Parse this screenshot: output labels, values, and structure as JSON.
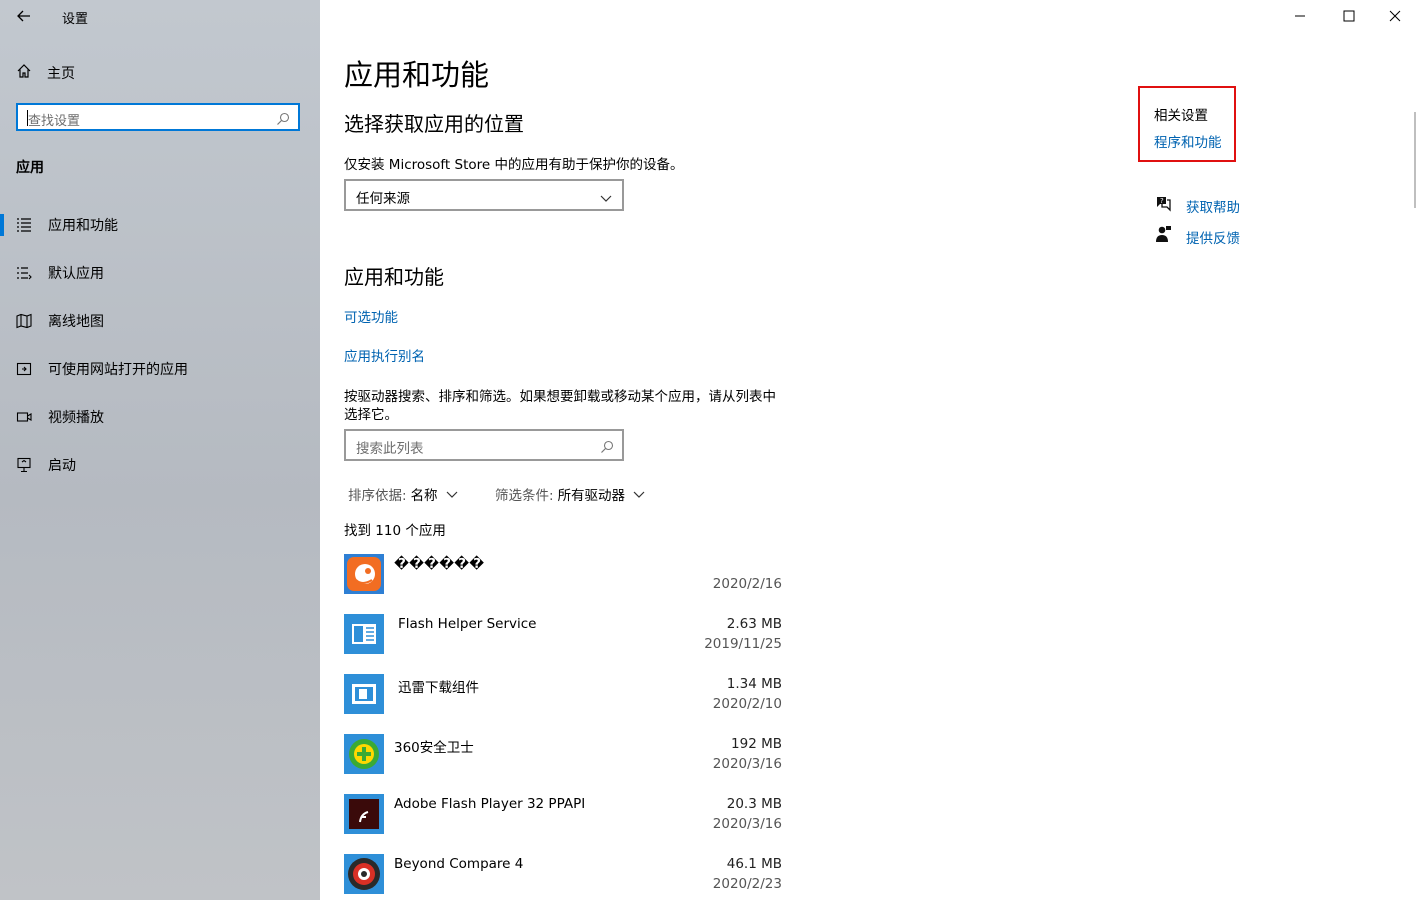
{
  "window": {
    "title": "设置"
  },
  "sidebar": {
    "home_label": "主页",
    "search_placeholder": "查找设置",
    "section_title": "应用",
    "items": [
      {
        "label": "应用和功能",
        "icon": "apps-list-icon",
        "selected": true
      },
      {
        "label": "默认应用",
        "icon": "default-apps-icon",
        "selected": false
      },
      {
        "label": "离线地图",
        "icon": "map-icon",
        "selected": false
      },
      {
        "label": "可使用网站打开的应用",
        "icon": "open-website-icon",
        "selected": false
      },
      {
        "label": "视频播放",
        "icon": "video-icon",
        "selected": false
      },
      {
        "label": "启动",
        "icon": "startup-icon",
        "selected": false
      }
    ]
  },
  "main": {
    "page_title": "应用和功能",
    "location_heading": "选择获取应用的位置",
    "location_desc": "仅安装 Microsoft Store 中的应用有助于保护你的设备。",
    "location_value": "任何来源",
    "apps_heading": "应用和功能",
    "link_optional": "可选功能",
    "link_alias": "应用执行别名",
    "list_desc_line1": "按驱动器搜索、排序和筛选。如果想要卸载或移动某个应用，请从列表中",
    "list_desc_line2": "选择它。",
    "list_search_placeholder": "搜索此列表",
    "sort_label": "排序依据:",
    "sort_value": "名称",
    "filter_label": "筛选条件:",
    "filter_value": "所有驱动器",
    "found_text": "找到 110 个应用",
    "apps": [
      {
        "name": "������",
        "size": "",
        "date": "2020/2/16",
        "icon": "orange-app-icon"
      },
      {
        "name": "Flash Helper Service",
        "size": "2.63 MB",
        "date": "2019/11/25",
        "icon": "flash-helper-icon"
      },
      {
        "name": "迅雷下载组件",
        "size": "1.34 MB",
        "date": "2020/2/10",
        "icon": "xunlei-component-icon"
      },
      {
        "name": "360安全卫士",
        "size": "192 MB",
        "date": "2020/3/16",
        "icon": "360-security-icon"
      },
      {
        "name": "Adobe Flash Player 32 PPAPI",
        "size": "20.3 MB",
        "date": "2020/3/16",
        "icon": "adobe-flash-icon"
      },
      {
        "name": "Beyond Compare 4",
        "size": "46.1 MB",
        "date": "2020/2/23",
        "icon": "beyond-compare-icon"
      }
    ]
  },
  "related": {
    "title": "相关设置",
    "link": "程序和功能",
    "get_help": "获取帮助",
    "feedback": "提供反馈"
  },
  "colors": {
    "accent": "#0078d7",
    "link": "#0063b1",
    "highlight_box": "#e01010"
  }
}
